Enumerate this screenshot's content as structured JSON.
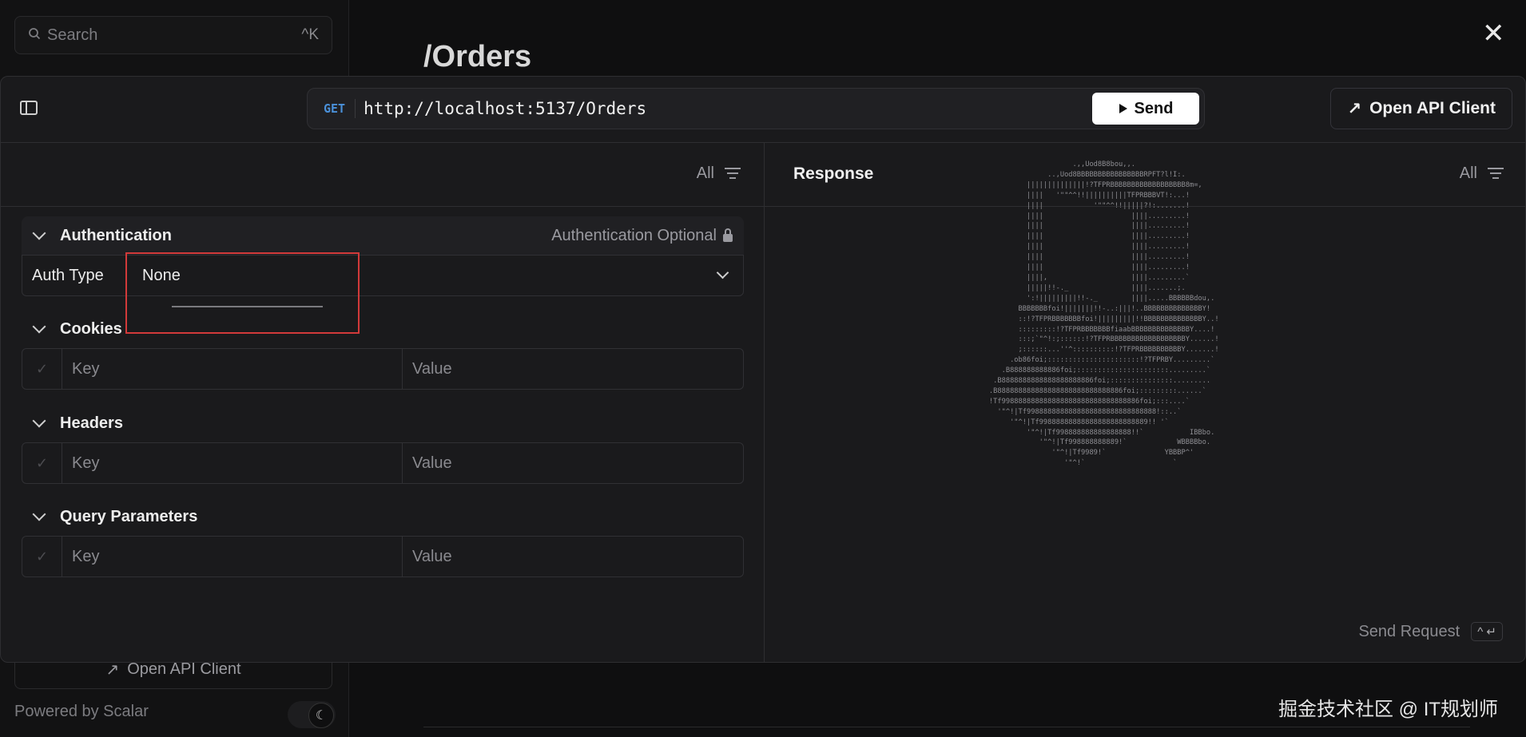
{
  "background": {
    "search_placeholder": "Search",
    "search_shortcut": "^K",
    "page_title": "/Orders",
    "open_api_client_label": "Open API Client",
    "powered_by": "Powered by Scalar",
    "close_label": "✕",
    "watermark": "掘金技术社区 @ IT规划师"
  },
  "request_bar": {
    "method": "GET",
    "url": "http://localhost:5137/Orders",
    "send_label": "Send",
    "open_client_label": "Open API Client"
  },
  "request_pane": {
    "filter_label": "All",
    "authentication": {
      "title": "Authentication",
      "optional_label": "Authentication Optional",
      "auth_type_label": "Auth Type",
      "auth_type_value": "None"
    },
    "cookies": {
      "title": "Cookies",
      "key_placeholder": "Key",
      "value_placeholder": "Value"
    },
    "headers": {
      "title": "Headers",
      "key_placeholder": "Key",
      "value_placeholder": "Value"
    },
    "query_parameters": {
      "title": "Query Parameters",
      "key_placeholder": "Key",
      "value_placeholder": "Value"
    }
  },
  "response_pane": {
    "title": "Response",
    "filter_label": "All",
    "send_request_label": "Send Request",
    "send_request_shortcut": "^ ↵"
  },
  "icons": {
    "sidebar_toggle": "sidebar-toggle-icon",
    "filter": "filter-icon",
    "lock": "lock-icon",
    "play": "play-icon",
    "external_arrow": "arrow-up-right-icon",
    "moon": "moon-icon",
    "close": "close-icon"
  },
  "colors": {
    "accent_method": "#4a90d9",
    "highlight_box": "#d23a3a",
    "background": "#0f0f10",
    "panel": "#1a1a1c"
  }
}
